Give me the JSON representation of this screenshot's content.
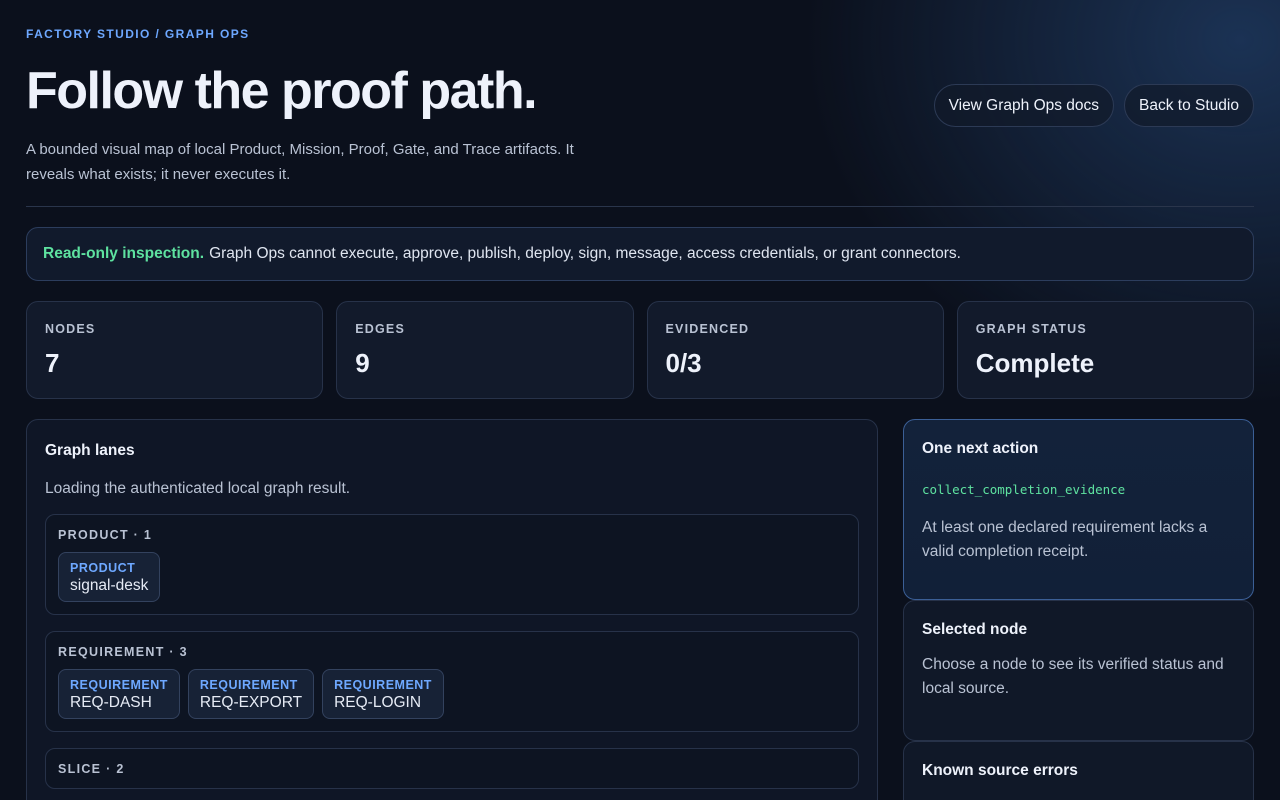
{
  "header": {
    "eyebrow": "FACTORY STUDIO / GRAPH OPS",
    "title": "Follow the proof path.",
    "subtitle": "A bounded visual map of local Product, Mission, Proof, Gate, and Trace artifacts. It reveals what exists; it never executes it.",
    "docs_button": "View Graph Ops docs",
    "back_button": "Back to Studio"
  },
  "notice": {
    "strong": "Read-only inspection.",
    "text": "Graph Ops cannot execute, approve, publish, deploy, sign, message, access credentials, or grant connectors."
  },
  "stats": [
    {
      "label": "NODES",
      "value": "7"
    },
    {
      "label": "EDGES",
      "value": "9"
    },
    {
      "label": "EVIDENCED",
      "value": "0/3"
    },
    {
      "label": "GRAPH STATUS",
      "value": "Complete"
    }
  ],
  "lanes_panel": {
    "title": "Graph lanes",
    "status": "Loading the authenticated local graph result.",
    "lanes": [
      {
        "label": "PRODUCT · 1",
        "nodes": [
          {
            "type": "PRODUCT",
            "name": "signal-desk"
          }
        ]
      },
      {
        "label": "REQUIREMENT · 3",
        "nodes": [
          {
            "type": "REQUIREMENT",
            "name": "REQ-DASH"
          },
          {
            "type": "REQUIREMENT",
            "name": "REQ-EXPORT"
          },
          {
            "type": "REQUIREMENT",
            "name": "REQ-LOGIN"
          }
        ]
      },
      {
        "label": "SLICE · 2",
        "nodes": []
      }
    ]
  },
  "next_action": {
    "title": "One next action",
    "code": "collect_completion_evidence",
    "text": "At least one declared requirement lacks a valid completion receipt."
  },
  "selected_node": {
    "title": "Selected node",
    "text": "Choose a node to see its verified status and local source."
  },
  "source_errors": {
    "title": "Known source errors"
  }
}
